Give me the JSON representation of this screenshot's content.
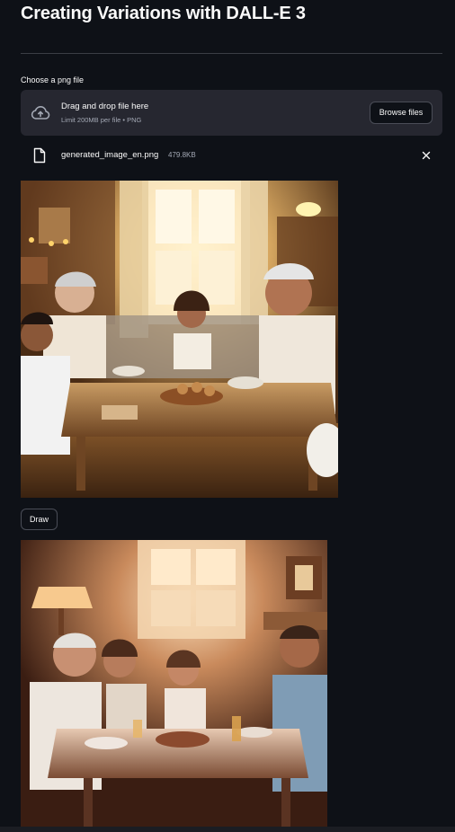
{
  "page": {
    "title": "Creating Variations with DALL-E 3"
  },
  "uploader": {
    "label": "Choose a png file",
    "drop_title": "Drag and drop file here",
    "drop_subtitle": "Limit 200MB per file • PNG",
    "browse_label": "Browse files",
    "icon": "cloud-upload-icon"
  },
  "uploaded_file": {
    "name": "generated_image_en.png",
    "size": "479.8KB",
    "icon": "file-icon",
    "remove_icon": "close-icon"
  },
  "actions": {
    "draw_label": "Draw"
  },
  "colors": {
    "background": "#0e1117",
    "panel": "#262730",
    "text": "#fafafa",
    "muted": "#a3a8b4",
    "border": "#4a4d57"
  }
}
